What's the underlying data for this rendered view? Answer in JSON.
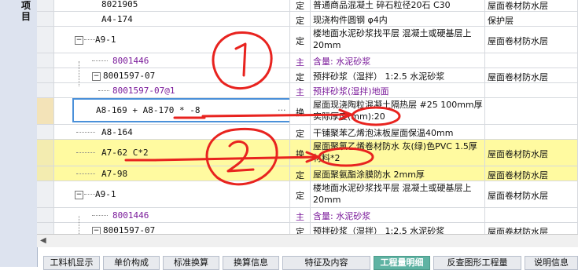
{
  "side_label": "项目",
  "rows": [
    {
      "code": "8021905",
      "unit": "定",
      "name": "普通商品混凝土 碎石粒径20石 C30",
      "spec": "屋面卷材防水层"
    },
    {
      "code": "A4-174",
      "unit": "定",
      "name": "现浇构件圆钢 φ4内",
      "spec": "保护层"
    },
    {
      "code": "A9-1",
      "unit": "定",
      "name": "楼地面水泥砂浆找平层 混凝土或硬基层上 20mm",
      "spec": "屋面卷材防水层"
    },
    {
      "code": "8001446",
      "unit": "主",
      "name": "含量: 水泥砂浆",
      "spec": ""
    },
    {
      "code": "8001597-07",
      "unit": "定",
      "name": "预拌砂浆（湿拌） 1:2.5 水泥砂浆",
      "spec": "屋面卷材防水层"
    },
    {
      "code": "8001597-07@1",
      "unit": "主",
      "name": "预拌砂浆(湿拌)地面",
      "spec": ""
    },
    {
      "code": "A8-169 + A8-170 * -8",
      "unit": "换",
      "name": "屋面现浇陶粒混凝土隔热层 #25 100mm厚 实际厚度(mm):20",
      "spec": ""
    },
    {
      "code": "A8-164",
      "unit": "定",
      "name": "干铺聚苯乙烯泡沫板屋面保温40mm",
      "spec": ""
    },
    {
      "code": "A7-62 C*2",
      "unit": "换",
      "name": "屋面聚氯乙烯卷材防水 灰(绿)色PVC 1.5厚 材料*2",
      "spec": "屋面卷材防水层"
    },
    {
      "code": "A7-98",
      "unit": "定",
      "name": "屋面聚氨酯涂膜防水 2mm厚",
      "spec": "屋面卷材防水层"
    },
    {
      "code": "A9-1",
      "unit": "定",
      "name": "楼地面水泥砂浆找平层 混凝土或硬基层上 20mm",
      "spec": "屋面卷材防水层"
    },
    {
      "code": "8001446",
      "unit": "主",
      "name": "含量: 水泥砂浆",
      "spec": ""
    },
    {
      "code": "8001597-07",
      "unit": "定",
      "name": "预拌砂浆（湿拌） 1:2.5 水泥砂浆",
      "spec": "屋面卷材防水层"
    }
  ],
  "tabs": [
    "工料机显示",
    "单价构成",
    "标准换算",
    "换算信息",
    "特征及内容",
    "工程量明细",
    "反查图形工程量",
    "说明信息"
  ],
  "active_tab": "工程量明细",
  "annotations": {
    "circle1": "1",
    "circle2": "2",
    "arrow_color": "#e8231f"
  }
}
